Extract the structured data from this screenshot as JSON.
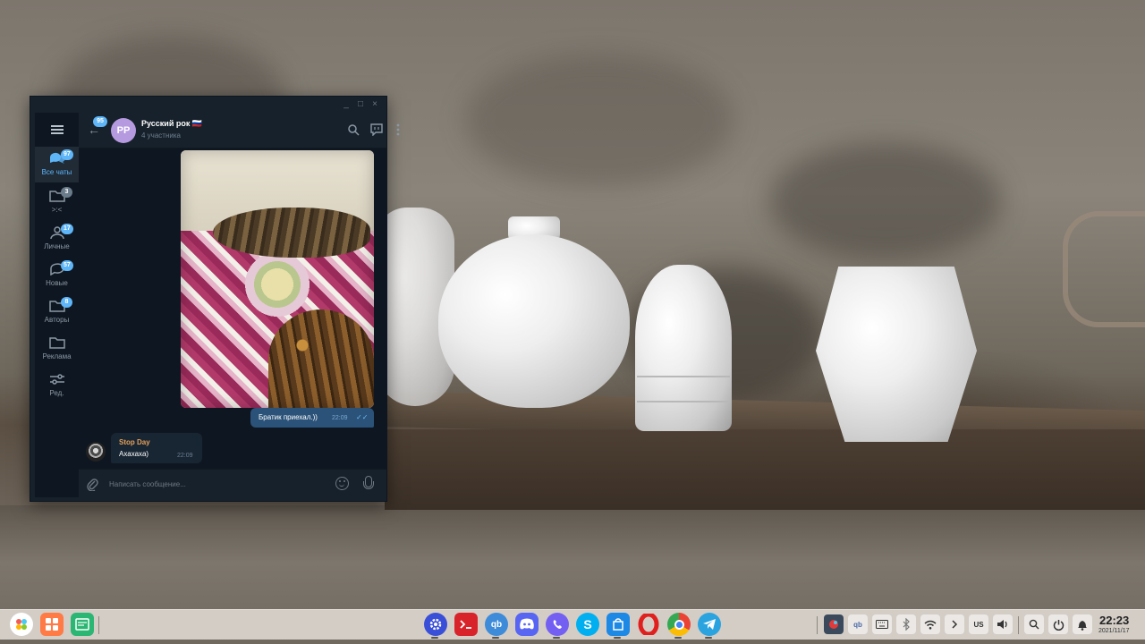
{
  "window": {
    "controls": [
      "_",
      "□",
      "×"
    ]
  },
  "sidebar": {
    "folders": [
      {
        "label": "Все чаты",
        "badge": "97",
        "icon": "chat-bubbles-icon",
        "active": true
      },
      {
        "label": ">:<",
        "badge": "3",
        "icon": "folder-icon",
        "active": false
      },
      {
        "label": "Личные",
        "badge": "17",
        "icon": "person-icon",
        "active": false
      },
      {
        "label": "Новые",
        "badge": "57",
        "icon": "chat-bubble-icon",
        "active": false
      },
      {
        "label": "Авторы",
        "badge": "8",
        "icon": "folder-icon",
        "active": false
      },
      {
        "label": "Реклама",
        "badge": "",
        "icon": "folder-icon",
        "active": false
      },
      {
        "label": "Ред.",
        "badge": "",
        "icon": "edit-sliders-icon",
        "active": false
      }
    ]
  },
  "header": {
    "back_badge": "95",
    "avatar_initials": "РР",
    "avatar_color": "#b69ae0",
    "title": "Русский рок 🇷🇺",
    "subtitle": "4 участника"
  },
  "messages": {
    "outgoing": {
      "text": "Братик приехал.))",
      "time": "22:09"
    },
    "incoming": {
      "sender": "Stop Day",
      "text": "Ахахаха)",
      "time": "22:09"
    }
  },
  "compose": {
    "placeholder": "Написать сообщение..."
  },
  "taskbar": {
    "keyboard_layout": "US",
    "clock_time": "22:23",
    "clock_date": "2021/11/17",
    "apps": [
      "launcher",
      "multitasking",
      "desktop",
      "settings",
      "terminal",
      "qbittorrent",
      "discord",
      "viber",
      "skype",
      "appstore",
      "opera",
      "chrome",
      "telegram"
    ]
  },
  "colors": {
    "accent": "#5eb5f7",
    "window_bg": "#17212b",
    "chat_bg": "#0e1621",
    "outgoing_bubble": "#2b5278",
    "incoming_bubble": "#182533",
    "sender_name": "#e5a15b"
  }
}
